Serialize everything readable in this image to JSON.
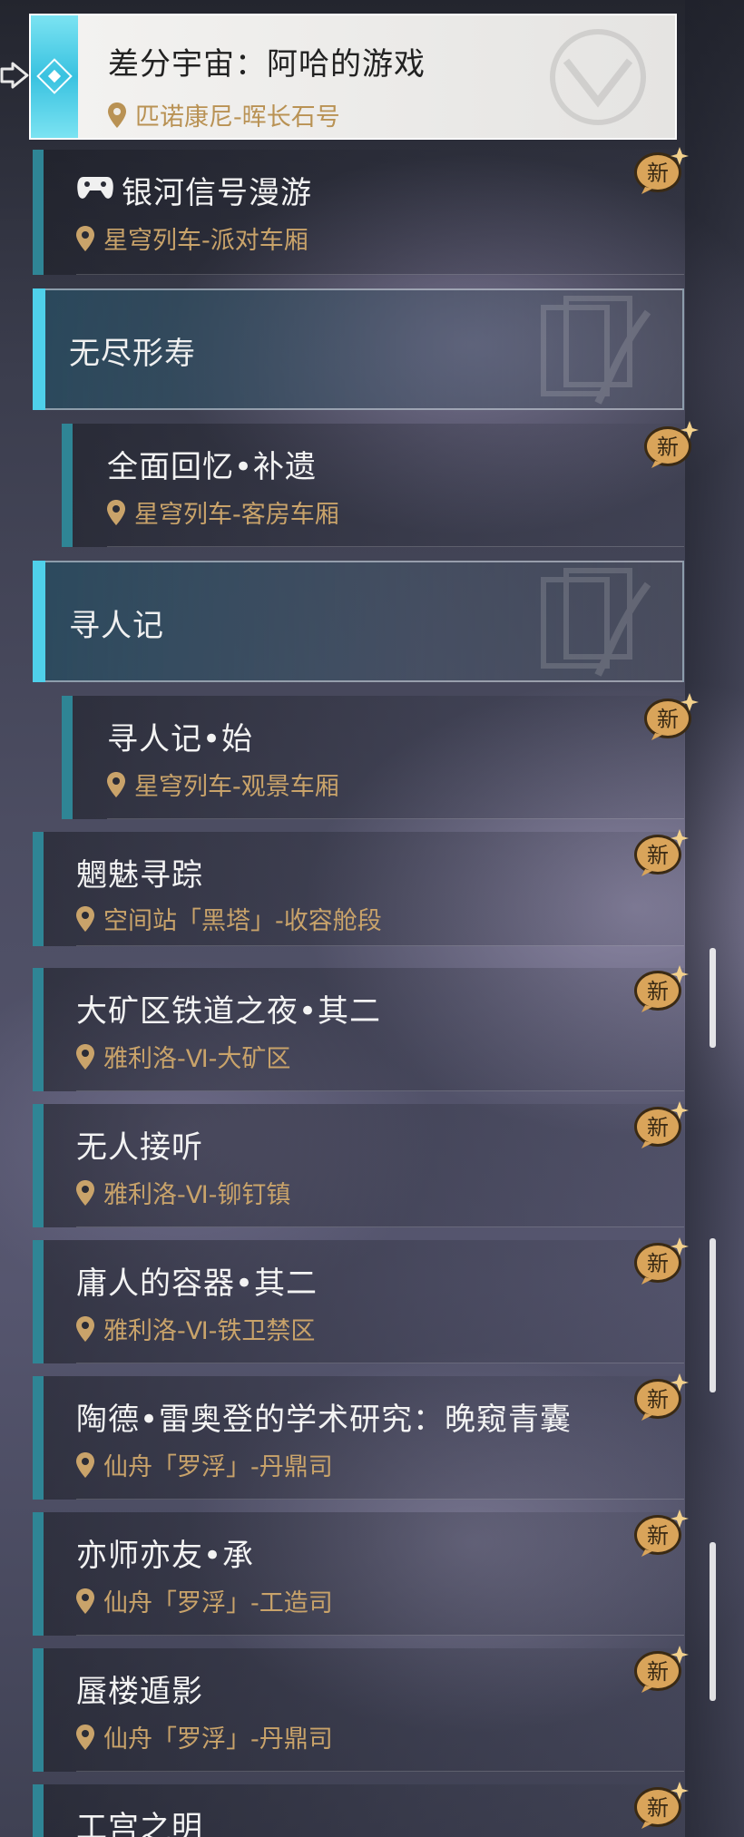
{
  "selected": {
    "title": "差分宇宙：阿哈的游戏",
    "location": "匹诺康尼-晖长石号"
  },
  "badge_label": "新",
  "categories": [
    {
      "label": "无尽形寿"
    },
    {
      "label": "寻人记"
    }
  ],
  "quests": [
    {
      "title": "银河信号漫游",
      "location": "星穹列车-派对车厢",
      "is_new": true
    },
    {
      "title": "全面回忆•补遗",
      "location": "星穹列车-客房车厢",
      "is_new": true
    },
    {
      "title": "寻人记•始",
      "location": "星穹列车-观景车厢",
      "is_new": true
    },
    {
      "title": "魍魅寻踪",
      "location": "空间站「黑塔」-收容舱段",
      "is_new": true
    },
    {
      "title": "大矿区铁道之夜•其二",
      "location": "雅利洛-Ⅵ-大矿区",
      "is_new": true
    },
    {
      "title": "无人接听",
      "location": "雅利洛-Ⅵ-铆钉镇",
      "is_new": true
    },
    {
      "title": "庸人的容器•其二",
      "location": "雅利洛-Ⅵ-铁卫禁区",
      "is_new": true
    },
    {
      "title": "陶德•雷奥登的学术研究：晚窥青囊",
      "location": "仙舟「罗浮」-丹鼎司",
      "is_new": true
    },
    {
      "title": "亦师亦友•承",
      "location": "仙舟「罗浮」-工造司",
      "is_new": true
    },
    {
      "title": "蜃楼遁影",
      "location": "仙舟「罗浮」-丹鼎司",
      "is_new": true
    },
    {
      "title": "工宫之明",
      "location": "",
      "is_new": true
    }
  ],
  "colors": {
    "accent_cyan": "#4fd0ea",
    "row_bar": "#2f8595",
    "location_gold": "#c9a36a",
    "badge_gold": "#d9a45a"
  },
  "icons": [
    "selector-arrow-icon",
    "quest-emblem-icon",
    "location-pin-icon",
    "new-badge-icon",
    "game-controller-icon",
    "card-watermark-icon"
  ]
}
